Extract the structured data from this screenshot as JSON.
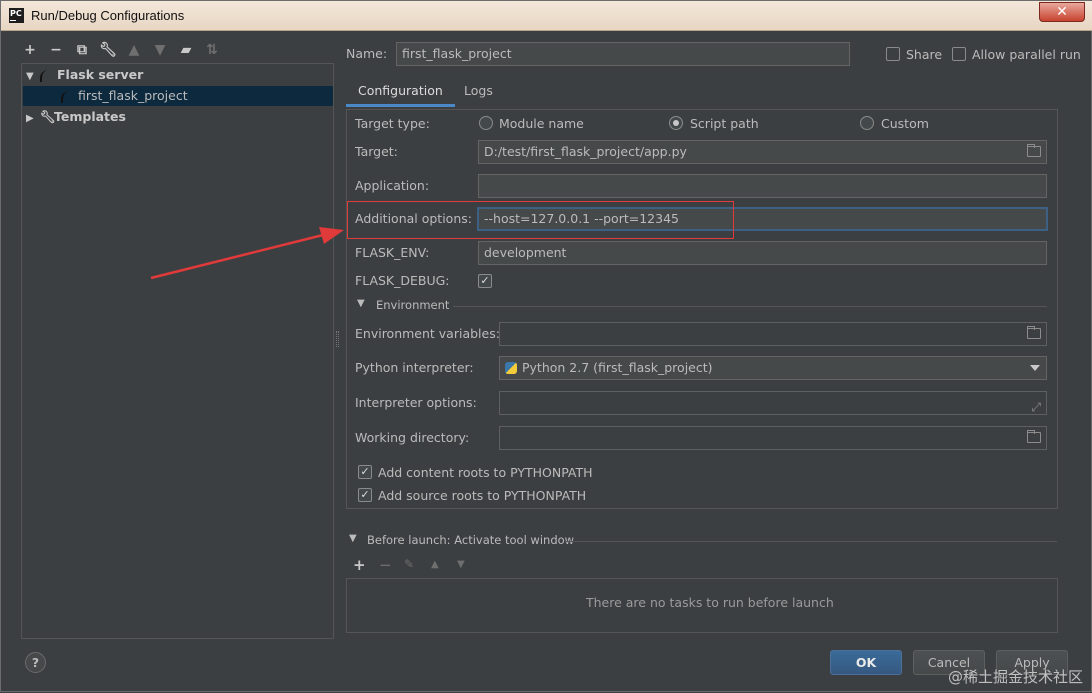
{
  "window": {
    "title": "Run/Debug Configurations",
    "logo_text": "PC"
  },
  "sidebar": {
    "tree": [
      {
        "label": "Flask server",
        "expanded": true
      },
      {
        "label": "first_flask_project",
        "selected": true
      },
      {
        "label": "Templates",
        "expanded": false
      }
    ]
  },
  "header": {
    "name_label": "Name:",
    "name_value": "first_flask_project",
    "share_label": "Share",
    "parallel_label": "Allow parallel run"
  },
  "tabs": [
    {
      "label": "Configuration"
    },
    {
      "label": "Logs"
    }
  ],
  "config": {
    "target_type_label": "Target type:",
    "target_type_options": [
      "Module name",
      "Script path",
      "Custom"
    ],
    "target_type_selected": "Script path",
    "target_label": "Target:",
    "target_value": "D:/test/first_flask_project/app.py",
    "application_label": "Application:",
    "application_value": "",
    "additional_label": "Additional options:",
    "additional_value": "--host=127.0.0.1 --port=12345",
    "flask_env_label": "FLASK_ENV:",
    "flask_env_value": "development",
    "flask_debug_label": "FLASK_DEBUG:",
    "flask_debug_checked": true,
    "environment_section": "Environment",
    "env_vars_label": "Environment variables:",
    "interpreter_label": "Python interpreter:",
    "interpreter_value": "Python 2.7 (first_flask_project)",
    "interp_options_label": "Interpreter options:",
    "working_dir_label": "Working directory:",
    "content_roots_label": "Add content roots to PYTHONPATH",
    "source_roots_label": "Add source roots to PYTHONPATH"
  },
  "before_launch": {
    "title": "Before launch: Activate tool window",
    "empty_text": "There are no tasks to run before launch"
  },
  "buttons": {
    "ok": "OK",
    "cancel": "Cancel",
    "apply": "Apply",
    "help": "?"
  },
  "watermark": "@稀土掘金技术社区",
  "colors": {
    "accent": "#4a88c7",
    "selection": "#0d293e",
    "annotation": "#e03a3a"
  }
}
